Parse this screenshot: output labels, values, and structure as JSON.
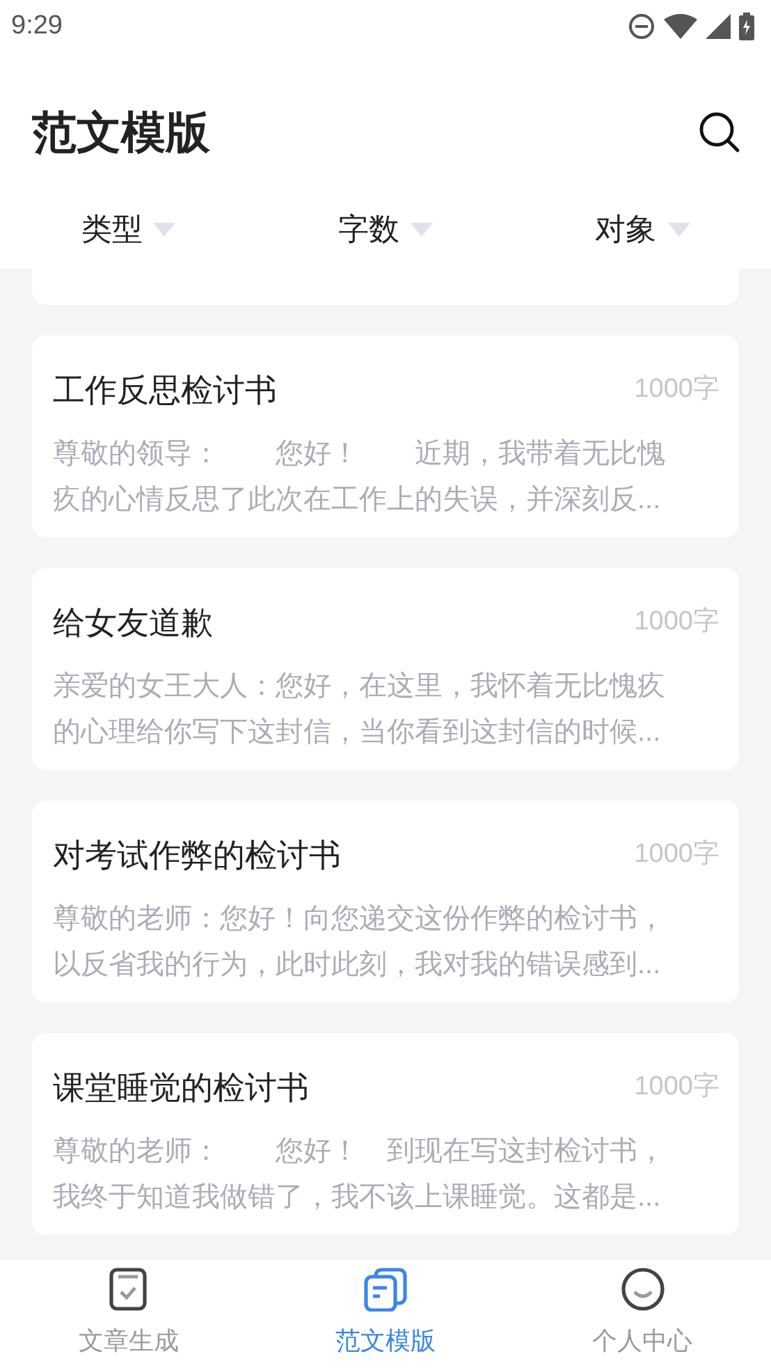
{
  "status_bar": {
    "time": "9:29"
  },
  "header": {
    "title": "范文模版"
  },
  "filters": [
    {
      "label": "类型"
    },
    {
      "label": "字数"
    },
    {
      "label": "对象"
    }
  ],
  "cards": [
    {
      "title": "工作反思检讨书",
      "count": "1000字",
      "preview": "尊敬的领导：　　您好！　　近期，我带着无比愧疚的心情反思了此次在工作上的失误，并深刻反..."
    },
    {
      "title": "给女友道歉",
      "count": "1000字",
      "preview": "亲爱的女王大人：您好，在这里，我怀着无比愧疚的心理给你写下这封信，当你看到这封信的时候..."
    },
    {
      "title": "对考试作弊的检讨书",
      "count": "1000字",
      "preview": "尊敬的老师：您好！向您递交这份作弊的检讨书，以反省我的行为，此时此刻，我对我的错误感到..."
    },
    {
      "title": "课堂睡觉的检讨书",
      "count": "1000字",
      "preview": "尊敬的老师：　　您好！　到现在写这封检讨书，我终于知道我做错了，我不该上课睡觉。这都是..."
    }
  ],
  "tab_bar": [
    {
      "label": "文章生成",
      "kind": "doc",
      "selected": false
    },
    {
      "label": "范文模版",
      "kind": "docs",
      "selected": true
    },
    {
      "label": "个人中心",
      "kind": "smile",
      "selected": false
    }
  ]
}
